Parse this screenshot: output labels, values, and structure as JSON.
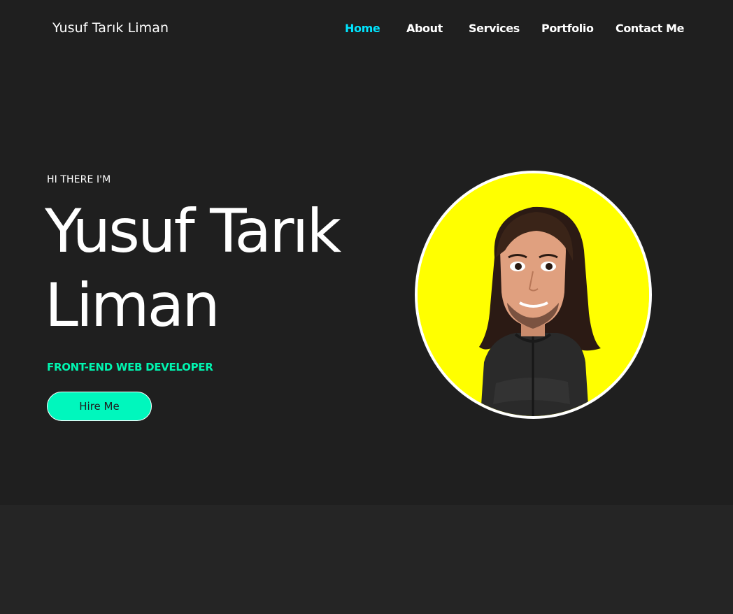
{
  "header": {
    "brand": "Yusuf Tarık Liman",
    "nav": [
      {
        "label": "Home",
        "active": true
      },
      {
        "label": "About",
        "active": false
      },
      {
        "label": "Services",
        "active": false
      },
      {
        "label": "Portfolio",
        "active": false
      },
      {
        "label": "Contact Me",
        "active": false
      }
    ]
  },
  "hero": {
    "greeting": "HI THERE I'M",
    "name_line1": "Yusuf Tarık",
    "name_line2": "Liman",
    "role": "FRONT-END WEB DEVELOPER",
    "cta_label": "Hire Me",
    "avatar_icon": "avatar-illustration"
  },
  "colors": {
    "background": "#1f1f1f",
    "section_below": "#252525",
    "nav_active": "#00e5ff",
    "accent": "#00f5b0",
    "button": "#00f7bd",
    "avatar_bg": "#ffff00"
  }
}
